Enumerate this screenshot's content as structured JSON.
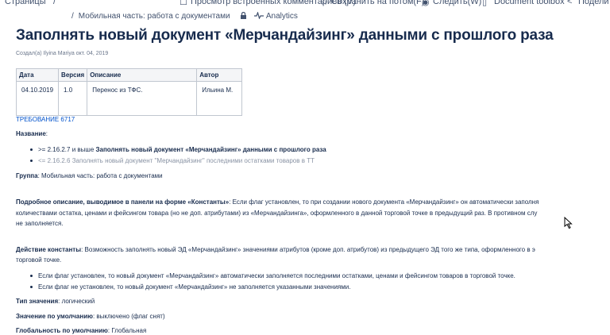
{
  "topbar": {
    "pages": "Страницы",
    "sep": "/",
    "inline_comments": "Просмотр встроенных комментариев (V)",
    "save_later": "Сохранить на потом(F)",
    "watch": "Следить(W)",
    "doc_toolbox": "Document toolbox",
    "share": "Поделить"
  },
  "breadcrumbs": {
    "sep": "/",
    "parent": "Мобильная часть: работа с документами",
    "analytics": "Analytics"
  },
  "page": {
    "title": "Заполнять новый документ «Мерчандайзинг» данными с прошлого раза",
    "created_by": "Создал(а) Ilyina Mariya окт. 04, 2019"
  },
  "history_table": {
    "headers": [
      "Дата",
      "Версия",
      "Описание",
      "Автор"
    ],
    "rows": [
      [
        "04.10.2019",
        "1.0",
        "Перенос из ТФС.",
        "Ильина М."
      ]
    ]
  },
  "requirement": "ТРЕБОВАНИЕ 6717",
  "name_label": "Название",
  "name_items": [
    {
      "prefix": ">= 2.16.2.7 и выше ",
      "text": "Заполнять новый документ «Мерчандайзинг» данными с прошлого раза"
    },
    {
      "prefix": "<= 2.16.2.6 ",
      "text": "Заполнять новый документ \"Мерчандайзинг\" последними остатками товаров в ТТ"
    }
  ],
  "group": {
    "label": "Группа",
    "value": "Мобильная часть: работа с документами"
  },
  "detail": {
    "label": "Подробное описание, выводимое в панели на форме «Константы»",
    "line1": "Если флаг установлен, то при создании нового документа «Мерчандайзинг» он автоматически заполня",
    "line2": "количествами остатка, ценами и фейсингом товара (но не доп. атрибутами) из «Мерчандайзинга», оформленного в данной торговой точке в предыдущий раз. В противном слу",
    "line3": "не заполняется."
  },
  "action": {
    "label": "Действие константы",
    "line1": "Возможность заполнять новый ЭД «Мерчандайзинг» значениями атрибутов (кроме доп. атрибутов) из предыдущего ЭД того же типа, оформленного в э",
    "line2": "торговой точке.",
    "items": [
      "Если флаг установлен, то новый документ «Мерчандайзинг» автоматически заполняется последними остатками, ценами и фейсингом товаров в торговой точке.",
      "Если флаг не установлен, то новый документ «Мерчандайзинг» не заполняется указанными значениями."
    ]
  },
  "value_type": {
    "label": "Тип значения",
    "value": "логический"
  },
  "default": {
    "label": "Значение по умолчанию",
    "value": "выключено (флаг снят)"
  },
  "global": {
    "label": "Глобальность по умолчанию",
    "value": "Глобальная"
  }
}
